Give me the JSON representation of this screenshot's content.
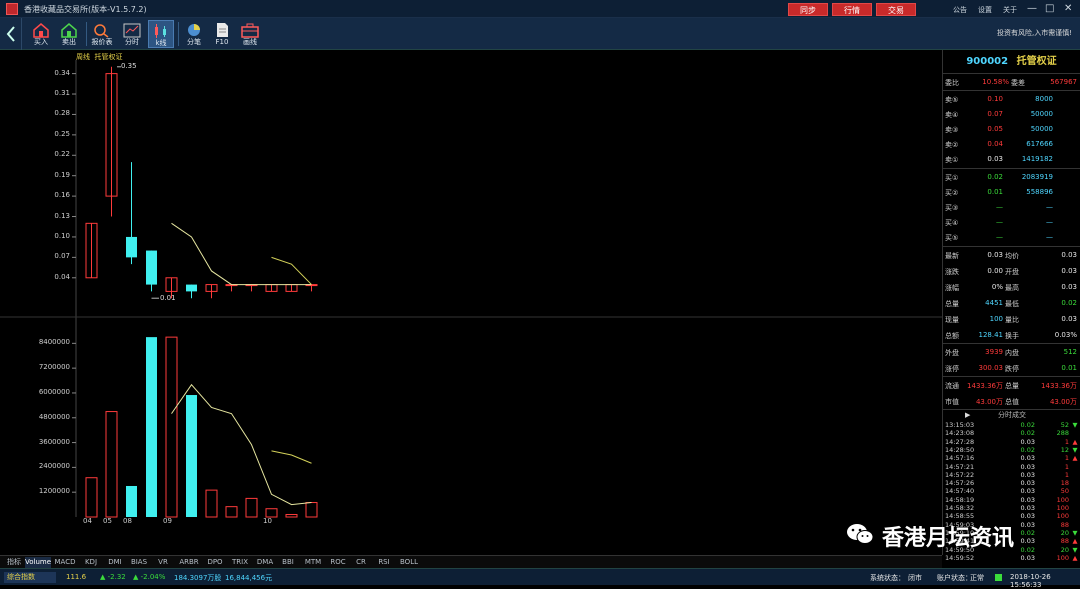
{
  "window": {
    "title": "香港收藏品交易所(版本-V1.5.7.2)",
    "top_buttons": [
      "同步",
      "行情",
      "交易"
    ],
    "top_links": [
      "公告",
      "设置",
      "关于"
    ],
    "controls": [
      "—",
      "□",
      "✕"
    ]
  },
  "toolbar": {
    "tools": [
      {
        "label": "买入",
        "icon": "buy-house-icon"
      },
      {
        "label": "卖出",
        "icon": "sell-house-icon"
      },
      {
        "label": "报价表",
        "icon": "quote-table-icon"
      },
      {
        "label": "分时",
        "icon": "timeshare-grid-icon"
      },
      {
        "label": "k线",
        "icon": "kline-icon"
      },
      {
        "label": "分笔",
        "icon": "pie-chart-icon"
      },
      {
        "label": "F10",
        "icon": "document-icon"
      },
      {
        "label": "画线",
        "icon": "briefcase-icon"
      }
    ],
    "risk_note": "投资有风险,入市需谨慎!"
  },
  "chart": {
    "period": "周线",
    "instrument": "托管权证",
    "max_marker": "0.35",
    "min_marker": "0.01",
    "price_ticks": [
      "0.34",
      "0.31",
      "0.28",
      "0.25",
      "0.22",
      "0.19",
      "0.16",
      "0.13",
      "0.10",
      "0.07",
      "0.04"
    ],
    "volume_ticks": [
      "8400000",
      "7200000",
      "6000000",
      "4800000",
      "3600000",
      "2400000",
      "1200000"
    ],
    "x_labels": [
      "04",
      "05",
      "08",
      "09",
      "10"
    ]
  },
  "chart_data": {
    "type": "candlestick",
    "price_range": [
      0.0,
      0.36
    ],
    "volume_range": [
      0,
      8900000
    ],
    "candles": [
      {
        "o": 0.04,
        "c": 0.12,
        "h": 0.12,
        "l": 0.04,
        "dir": "up"
      },
      {
        "o": 0.16,
        "c": 0.34,
        "h": 0.35,
        "l": 0.13,
        "dir": "up"
      },
      {
        "o": 0.1,
        "c": 0.07,
        "h": 0.21,
        "l": 0.06,
        "dir": "down"
      },
      {
        "o": 0.08,
        "c": 0.03,
        "h": 0.08,
        "l": 0.02,
        "dir": "down"
      },
      {
        "o": 0.02,
        "c": 0.04,
        "h": 0.04,
        "l": 0.01,
        "dir": "up"
      },
      {
        "o": 0.03,
        "c": 0.02,
        "h": 0.03,
        "l": 0.01,
        "dir": "down"
      },
      {
        "o": 0.02,
        "c": 0.03,
        "h": 0.03,
        "l": 0.01,
        "dir": "up"
      },
      {
        "o": 0.03,
        "c": 0.03,
        "h": 0.03,
        "l": 0.02,
        "dir": "up"
      },
      {
        "o": 0.03,
        "c": 0.03,
        "h": 0.03,
        "l": 0.02,
        "dir": "up"
      },
      {
        "o": 0.02,
        "c": 0.03,
        "h": 0.03,
        "l": 0.02,
        "dir": "up"
      },
      {
        "o": 0.02,
        "c": 0.03,
        "h": 0.03,
        "l": 0.02,
        "dir": "up"
      },
      {
        "o": 0.03,
        "c": 0.03,
        "h": 0.03,
        "l": 0.02,
        "dir": "up"
      }
    ],
    "ma_price": [
      null,
      null,
      null,
      null,
      0.12,
      0.1,
      0.05,
      0.03,
      0.03,
      0.03,
      0.03,
      0.03
    ],
    "ma_price2": [
      null,
      null,
      null,
      null,
      null,
      null,
      null,
      null,
      null,
      0.07,
      0.06,
      0.03
    ],
    "volumes": [
      {
        "v": 1900000,
        "dir": "up"
      },
      {
        "v": 5100000,
        "dir": "up"
      },
      {
        "v": 1500000,
        "dir": "down"
      },
      {
        "v": 8700000,
        "dir": "down"
      },
      {
        "v": 8700000,
        "dir": "up"
      },
      {
        "v": 5900000,
        "dir": "down"
      },
      {
        "v": 1300000,
        "dir": "up"
      },
      {
        "v": 500000,
        "dir": "up"
      },
      {
        "v": 900000,
        "dir": "up"
      },
      {
        "v": 400000,
        "dir": "up"
      },
      {
        "v": 120000,
        "dir": "up"
      },
      {
        "v": 700000,
        "dir": "up"
      }
    ],
    "ma_volume": [
      null,
      null,
      null,
      null,
      5000000,
      6400000,
      5300000,
      5000000,
      3500000,
      1100000,
      600000,
      700000
    ],
    "ma_volume2": [
      null,
      null,
      null,
      null,
      null,
      null,
      null,
      null,
      null,
      3200000,
      3000000,
      2600000
    ]
  },
  "quote": {
    "code": "900002",
    "name": "托管权证",
    "wei_bi_label": "委比",
    "wei_bi": "10.58%",
    "wei_cha_label": "委差",
    "wei_cha": "567967",
    "asks": [
      {
        "label": "卖⑤",
        "price": "0.10",
        "vol": "8000"
      },
      {
        "label": "卖④",
        "price": "0.07",
        "vol": "50000"
      },
      {
        "label": "卖③",
        "price": "0.05",
        "vol": "50000"
      },
      {
        "label": "卖②",
        "price": "0.04",
        "vol": "617666"
      },
      {
        "label": "卖①",
        "price": "0.03",
        "vol": "1419182"
      }
    ],
    "bids": [
      {
        "label": "买①",
        "price": "0.02",
        "vol": "2083919"
      },
      {
        "label": "买②",
        "price": "0.01",
        "vol": "558896"
      },
      {
        "label": "买③",
        "price": "—",
        "vol": "—"
      },
      {
        "label": "买④",
        "price": "—",
        "vol": "—"
      },
      {
        "label": "买⑤",
        "price": "—",
        "vol": "—"
      }
    ],
    "stats": [
      {
        "l1": "最新",
        "v1": "0.03",
        "c1": "white",
        "l2": "均价",
        "v2": "0.03",
        "c2": "white"
      },
      {
        "l1": "涨跌",
        "v1": "0.00",
        "c1": "white",
        "l2": "开盘",
        "v2": "0.03",
        "c2": "white"
      },
      {
        "l1": "涨幅",
        "v1": "0%",
        "c1": "white",
        "l2": "最高",
        "v2": "0.03",
        "c2": "white"
      },
      {
        "l1": "总量",
        "v1": "4451",
        "c1": "cyan",
        "l2": "最低",
        "v2": "0.02",
        "c2": "green"
      },
      {
        "l1": "现量",
        "v1": "100",
        "c1": "cyan",
        "l2": "量比",
        "v2": "0.03",
        "c2": "white"
      },
      {
        "l1": "总额",
        "v1": "128.41",
        "c1": "cyan",
        "l2": "换手",
        "v2": "0.03%",
        "c2": "white"
      },
      {
        "l1": "外盘",
        "v1": "3939",
        "c1": "red",
        "l2": "内盘",
        "v2": "512",
        "c2": "green"
      },
      {
        "l1": "涨停",
        "v1": "300.03",
        "c1": "red",
        "l2": "跌停",
        "v2": "0.01",
        "c2": "green"
      },
      {
        "l1": "流通",
        "v1": "1433.36万",
        "c1": "red",
        "l2": "总量",
        "v2": "1433.36万",
        "c2": "red"
      },
      {
        "l1": "市值",
        "v1": "43.00万",
        "c1": "red",
        "l2": "总值",
        "v2": "43.00万",
        "c2": "red"
      }
    ],
    "ticks_header": "分时成交",
    "ticks": [
      {
        "t": "13:15:03",
        "p": "0.02",
        "pc": "green",
        "v": "52",
        "a": "▼",
        "ac": "green"
      },
      {
        "t": "14:23:08",
        "p": "0.02",
        "pc": "green",
        "v": "288",
        "a": "",
        "ac": "green"
      },
      {
        "t": "14:27:28",
        "p": "0.03",
        "pc": "white",
        "v": "1",
        "a": "▲",
        "ac": "red"
      },
      {
        "t": "14:28:50",
        "p": "0.02",
        "pc": "green",
        "v": "12",
        "a": "▼",
        "ac": "green"
      },
      {
        "t": "14:57:16",
        "p": "0.03",
        "pc": "white",
        "v": "1",
        "a": "▲",
        "ac": "red"
      },
      {
        "t": "14:57:21",
        "p": "0.03",
        "pc": "white",
        "v": "1",
        "a": "",
        "ac": "red"
      },
      {
        "t": "14:57:22",
        "p": "0.03",
        "pc": "white",
        "v": "1",
        "a": "",
        "ac": "red"
      },
      {
        "t": "14:57:26",
        "p": "0.03",
        "pc": "white",
        "v": "18",
        "a": "",
        "ac": "red"
      },
      {
        "t": "14:57:40",
        "p": "0.03",
        "pc": "white",
        "v": "50",
        "a": "",
        "ac": "red"
      },
      {
        "t": "14:58:19",
        "p": "0.03",
        "pc": "white",
        "v": "100",
        "a": "",
        "ac": "red"
      },
      {
        "t": "14:58:32",
        "p": "0.03",
        "pc": "white",
        "v": "100",
        "a": "",
        "ac": "red"
      },
      {
        "t": "14:58:55",
        "p": "0.03",
        "pc": "white",
        "v": "100",
        "a": "",
        "ac": "red"
      },
      {
        "t": "14:59:03",
        "p": "0.03",
        "pc": "white",
        "v": "88",
        "a": "",
        "ac": "red"
      },
      {
        "t": "14:59:10",
        "p": "0.02",
        "pc": "green",
        "v": "20",
        "a": "▼",
        "ac": "green"
      },
      {
        "t": "14:59:41",
        "p": "0.03",
        "pc": "white",
        "v": "88",
        "a": "▲",
        "ac": "red"
      },
      {
        "t": "14:59:50",
        "p": "0.02",
        "pc": "green",
        "v": "20",
        "a": "▼",
        "ac": "green"
      },
      {
        "t": "14:59:52",
        "p": "0.03",
        "pc": "white",
        "v": "100",
        "a": "▲",
        "ac": "red"
      }
    ]
  },
  "tabs": [
    "指标",
    "Volume",
    "MACD",
    "KDJ",
    "DMI",
    "BIAS",
    "VR",
    "ARBR",
    "DPO",
    "TRIX",
    "DMA",
    "BBI",
    "MTM",
    "ROC",
    "CR",
    "RSI",
    "BOLL"
  ],
  "status": {
    "index_label": "综合指数",
    "index_value": "111.6",
    "change": "▲ -2.32",
    "change_pct": "▲ -2.04%",
    "volume": "184.3097万股",
    "amount": "16,844,456元",
    "sys_label": "系统状态：",
    "sys_value": "闭市",
    "acct_label": "账户状态：",
    "acct_value": "正常",
    "datetime": "2018-10-26 15:56:33"
  },
  "watermark": "香港月坛资讯",
  "colors": {
    "up": "#ff3b3b",
    "down": "#40f0f0",
    "ma1": "#e6e6a0",
    "ma2": "#d4d25a"
  }
}
